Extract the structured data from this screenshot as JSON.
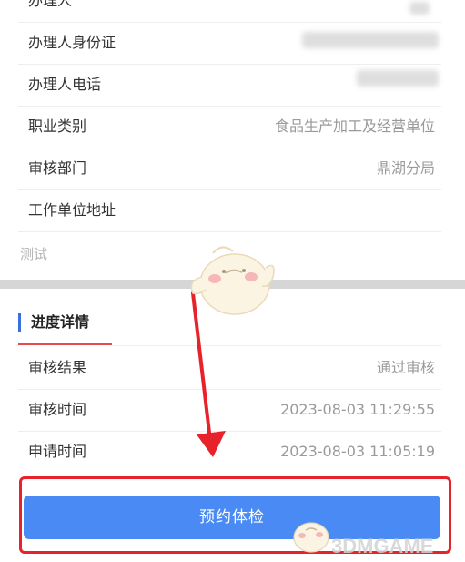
{
  "info_rows": [
    {
      "label": "办理人",
      "value": ""
    },
    {
      "label": "办理人身份证",
      "value": ""
    },
    {
      "label": "办理人电话",
      "value": ""
    },
    {
      "label": "职业类别",
      "value": "食品生产加工及经营单位"
    },
    {
      "label": "审核部门",
      "value": "鼎湖分局"
    },
    {
      "label": "工作单位地址",
      "value": ""
    }
  ],
  "address_note": "测试",
  "progress": {
    "title": "进度详情",
    "rows": [
      {
        "label": "审核结果",
        "value": "通过审核"
      },
      {
        "label": "审核时间",
        "value": "2023-08-03 11:29:55"
      },
      {
        "label": "申请时间",
        "value": "2023-08-03 11:05:19"
      }
    ]
  },
  "action_button": "预约体检",
  "watermark": "3DMGAME",
  "colors": {
    "accent": "#4a8af4",
    "highlight_red": "#e8222a",
    "section_bar": "#3a6fe0"
  }
}
